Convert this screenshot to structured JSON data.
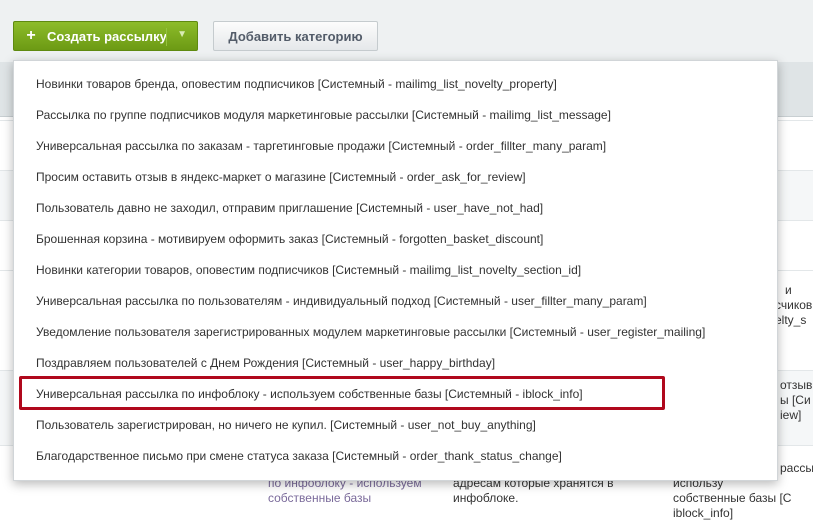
{
  "toolbar": {
    "create_label": "Создать рассылку",
    "create_icon": "plus-icon",
    "create_dropdown_icon": "chevron-down-icon",
    "add_category_label": "Добавить категорию",
    "accent_color": "#7aa81e"
  },
  "dropdown": {
    "items": [
      "Новинки товаров бренда, оповестим подписчиков [Системный - mailimg_list_novelty_property]",
      "Рассылка по группе подписчиков модуля маркетинговые рассылки [Системный - mailimg_list_message]",
      "Универсальная рассылка по заказам - таргетинговые продажи [Системный - order_fillter_many_param]",
      "Просим оставить отзыв в яндекс-маркет о магазине [Системный - order_ask_for_review]",
      "Пользователь давно не заходил, отправим приглашение [Системный - user_have_not_had]",
      "Брошенная корзина - мотивируем оформить заказ [Системный - forgotten_basket_discount]",
      "Новинки категории товаров, оповестим подписчиков [Системный - mailimg_list_novelty_section_id]",
      "Универсальная рассылка по пользователям - индивидуальный подход [Системный - user_fillter_many_param]",
      "Уведомление пользователя зарегистрированных модулем маркетинговые рассылки [Системный - user_register_mailing]",
      "Поздравляем пользователей с Днем Рождения [Системный - user_happy_birthday]",
      "Универсальная рассылка по инфоблоку - используем собственные базы [Системный - iblock_info]",
      "Пользователь зарегистрирован, но ничего не купил. [Системный - user_not_buy_anything]",
      "Благодарственное письмо при смене статуса заказа [Системный - order_thank_status_change]"
    ],
    "highlighted_index": 10,
    "highlight_color": "#b0081c"
  },
  "background_table": {
    "right_fragments": [
      "и",
      "счиков",
      "elty_s",
      "отзыв",
      "ы [Си",
      "iew]",
      "рассыл",
      "использу",
      "собственные базы [С",
      "iblock_info]"
    ],
    "col2_fragments": [
      "по инфоблоку - используем",
      "собственные базы"
    ],
    "col3_fragments": [
      "адресам которые хранятся в",
      "инфоблоке."
    ]
  }
}
